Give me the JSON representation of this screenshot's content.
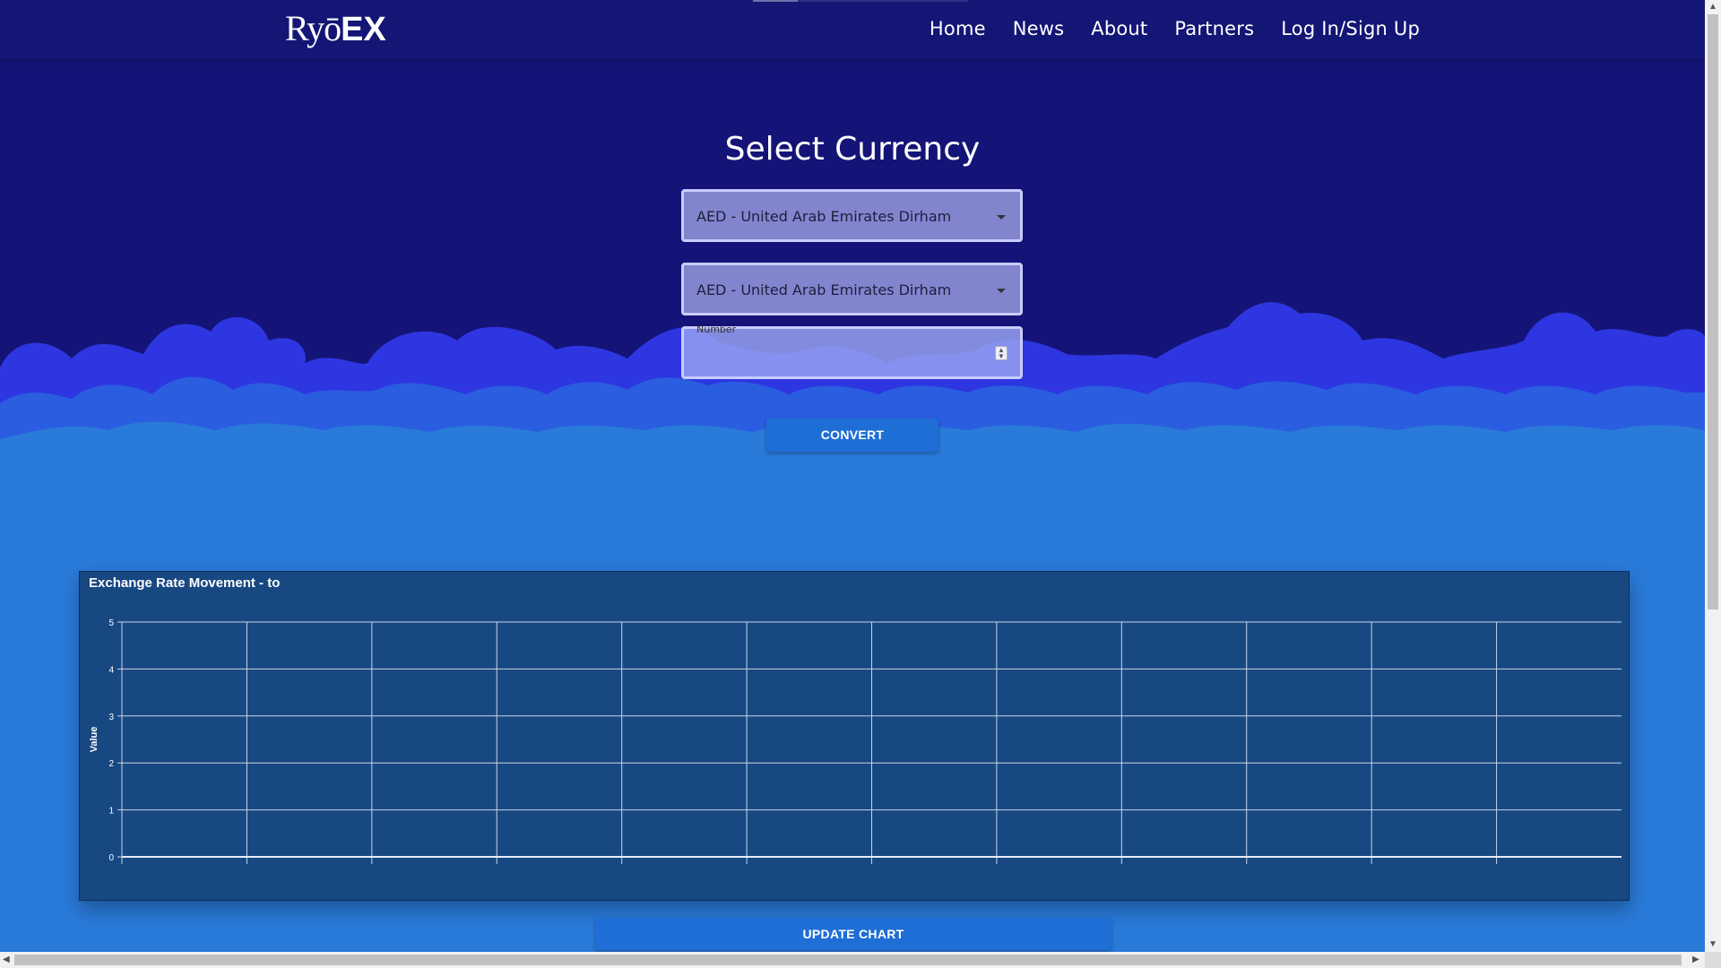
{
  "brand": {
    "logo_thin": "Ryō",
    "logo_bold": "EX"
  },
  "nav": {
    "items": [
      "Home",
      "News",
      "About",
      "Partners",
      "Log In/Sign Up"
    ]
  },
  "converter": {
    "title": "Select Currency",
    "from_currency": "AED - United Arab Emirates Dirham",
    "to_currency": "AED - United Arab Emirates Dirham",
    "amount_label": "Number",
    "amount_value": "",
    "convert_label": "CONVERT"
  },
  "chart_data": {
    "type": "line",
    "title": "Exchange Rate Movement - to",
    "xlabel": "",
    "ylabel": "Value",
    "ylim": [
      0,
      5
    ],
    "yticks": [
      0,
      1,
      2,
      3,
      4,
      5
    ],
    "x_gridlines": 12,
    "grid": true,
    "series": []
  },
  "update_chart_label": "UPDATE CHART",
  "colors": {
    "sky": "#141478",
    "navbar": "#131675",
    "cloud_back": "#2d36e0",
    "cloud_mid": "#2a5de0",
    "cloud_front": "#2a7ad9",
    "button": "#1e6ed6",
    "chart_bg": "#184882"
  }
}
